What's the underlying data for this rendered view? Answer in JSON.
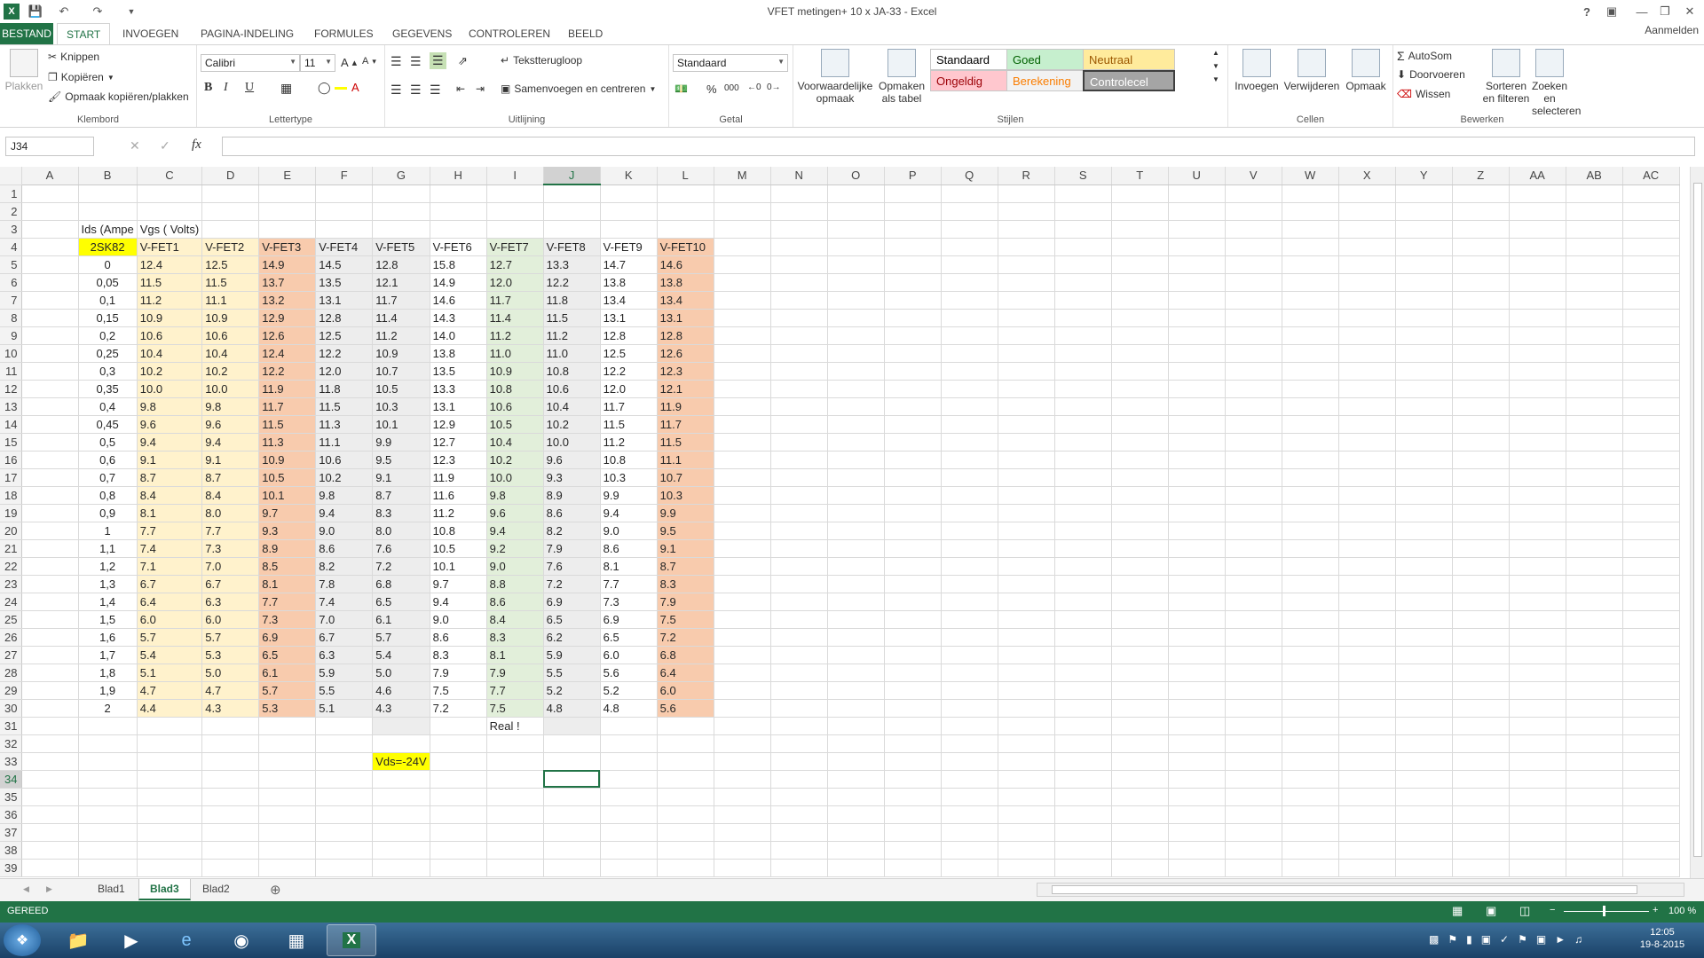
{
  "window": {
    "title": "VFET metingen+ 10 x JA-33 - Excel",
    "signin": "Aanmelden"
  },
  "quick_access": {
    "save_icon": "save-icon",
    "undo_icon": "undo-icon",
    "redo_icon": "redo-icon"
  },
  "ribbon_tabs": [
    "BESTAND",
    "START",
    "INVOEGEN",
    "PAGINA-INDELING",
    "FORMULES",
    "GEGEVENS",
    "CONTROLEREN",
    "BEELD"
  ],
  "clipboard": {
    "paste": "Plakken",
    "cut": "Knippen",
    "copy": "Kopiëren",
    "painter": "Opmaak kopiëren/plakken",
    "label": "Klembord"
  },
  "font": {
    "name": "Calibri",
    "size": "11",
    "label": "Lettertype",
    "bold": "B",
    "italic": "I",
    "underline": "U"
  },
  "alignment": {
    "wrap": "Tekstterugloop",
    "merge": "Samenvoegen en centreren",
    "label": "Uitlijning"
  },
  "number": {
    "format": "Standaard",
    "percent": "%",
    "thousands": "000",
    "label": "Getal"
  },
  "styles": {
    "cond": "Voorwaardelijke opmaak",
    "table": "Opmaken als tabel",
    "cells": [
      {
        "text": "Standaard",
        "bg": "#ffffff",
        "fg": "#000000"
      },
      {
        "text": "Goed",
        "bg": "#c6efce",
        "fg": "#006100"
      },
      {
        "text": "Neutraal",
        "bg": "#ffeb9c",
        "fg": "#9c5700"
      },
      {
        "text": "Ongeldig",
        "bg": "#ffc7ce",
        "fg": "#9c0006"
      },
      {
        "text": "Berekening",
        "bg": "#f2f2f2",
        "fg": "#fa7d00"
      },
      {
        "text": "Controlecel",
        "bg": "#a5a5a5",
        "fg": "#ffffff"
      }
    ],
    "label": "Stijlen"
  },
  "cells_group": {
    "insert": "Invoegen",
    "delete": "Verwijderen",
    "format": "Opmaak",
    "label": "Cellen"
  },
  "editing": {
    "autosum": "AutoSom",
    "fill": "Doorvoeren",
    "clear": "Wissen",
    "sort": "Sorteren en filteren",
    "find": "Zoeken en selecteren",
    "label": "Bewerken"
  },
  "formula_bar": {
    "name_box": "J34",
    "fx": "fx",
    "value": ""
  },
  "columns": [
    "A",
    "B",
    "C",
    "D",
    "E",
    "F",
    "G",
    "H",
    "I",
    "J",
    "K",
    "L",
    "M",
    "N",
    "O",
    "P",
    "Q",
    "R",
    "S",
    "T",
    "U",
    "V",
    "W",
    "X",
    "Y",
    "Z",
    "AA",
    "AB",
    "AC"
  ],
  "sheet": {
    "b3": "Ids (Ampe",
    "c3": "Vgs ( Volts)",
    "headers": [
      "2SK82",
      "V-FET1",
      "V-FET2",
      "V-FET3",
      "V-FET4",
      "V-FET5",
      "V-FET6",
      "V-FET7",
      "V-FET8",
      "V-FET9",
      "V-FET10"
    ],
    "rows": [
      [
        "0",
        "12.4",
        "12.5",
        "14.9",
        "14.5",
        "12.8",
        "15.8",
        "12.7",
        "13.3",
        "14.7",
        "14.6"
      ],
      [
        "0,05",
        "11.5",
        "11.5",
        "13.7",
        "13.5",
        "12.1",
        "14.9",
        "12.0",
        "12.2",
        "13.8",
        "13.8"
      ],
      [
        "0,1",
        "11.2",
        "11.1",
        "13.2",
        "13.1",
        "11.7",
        "14.6",
        "11.7",
        "11.8",
        "13.4",
        "13.4"
      ],
      [
        "0,15",
        "10.9",
        "10.9",
        "12.9",
        "12.8",
        "11.4",
        "14.3",
        "11.4",
        "11.5",
        "13.1",
        "13.1"
      ],
      [
        "0,2",
        "10.6",
        "10.6",
        "12.6",
        "12.5",
        "11.2",
        "14.0",
        "11.2",
        "11.2",
        "12.8",
        "12.8"
      ],
      [
        "0,25",
        "10.4",
        "10.4",
        "12.4",
        "12.2",
        "10.9",
        "13.8",
        "11.0",
        "11.0",
        "12.5",
        "12.6"
      ],
      [
        "0,3",
        "10.2",
        "10.2",
        "12.2",
        "12.0",
        "10.7",
        "13.5",
        "10.9",
        "10.8",
        "12.2",
        "12.3"
      ],
      [
        "0,35",
        "10.0",
        "10.0",
        "11.9",
        "11.8",
        "10.5",
        "13.3",
        "10.8",
        "10.6",
        "12.0",
        "12.1"
      ],
      [
        "0,4",
        "9.8",
        "9.8",
        "11.7",
        "11.5",
        "10.3",
        "13.1",
        "10.6",
        "10.4",
        "11.7",
        "11.9"
      ],
      [
        "0,45",
        "9.6",
        "9.6",
        "11.5",
        "11.3",
        "10.1",
        "12.9",
        "10.5",
        "10.2",
        "11.5",
        "11.7"
      ],
      [
        "0,5",
        "9.4",
        "9.4",
        "11.3",
        "11.1",
        "9.9",
        "12.7",
        "10.4",
        "10.0",
        "11.2",
        "11.5"
      ],
      [
        "0,6",
        "9.1",
        "9.1",
        "10.9",
        "10.6",
        "9.5",
        "12.3",
        "10.2",
        "9.6",
        "10.8",
        "11.1"
      ],
      [
        "0,7",
        "8.7",
        "8.7",
        "10.5",
        "10.2",
        "9.1",
        "11.9",
        "10.0",
        "9.3",
        "10.3",
        "10.7"
      ],
      [
        "0,8",
        "8.4",
        "8.4",
        "10.1",
        "9.8",
        "8.7",
        "11.6",
        "9.8",
        "8.9",
        "9.9",
        "10.3"
      ],
      [
        "0,9",
        "8.1",
        "8.0",
        "9.7",
        "9.4",
        "8.3",
        "11.2",
        "9.6",
        "8.6",
        "9.4",
        "9.9"
      ],
      [
        "1",
        "7.7",
        "7.7",
        "9.3",
        "9.0",
        "8.0",
        "10.8",
        "9.4",
        "8.2",
        "9.0",
        "9.5"
      ],
      [
        "1,1",
        "7.4",
        "7.3",
        "8.9",
        "8.6",
        "7.6",
        "10.5",
        "9.2",
        "7.9",
        "8.6",
        "9.1"
      ],
      [
        "1,2",
        "7.1",
        "7.0",
        "8.5",
        "8.2",
        "7.2",
        "10.1",
        "9.0",
        "7.6",
        "8.1",
        "8.7"
      ],
      [
        "1,3",
        "6.7",
        "6.7",
        "8.1",
        "7.8",
        "6.8",
        "9.7",
        "8.8",
        "7.2",
        "7.7",
        "8.3"
      ],
      [
        "1,4",
        "6.4",
        "6.3",
        "7.7",
        "7.4",
        "6.5",
        "9.4",
        "8.6",
        "6.9",
        "7.3",
        "7.9"
      ],
      [
        "1,5",
        "6.0",
        "6.0",
        "7.3",
        "7.0",
        "6.1",
        "9.0",
        "8.4",
        "6.5",
        "6.9",
        "7.5"
      ],
      [
        "1,6",
        "5.7",
        "5.7",
        "6.9",
        "6.7",
        "5.7",
        "8.6",
        "8.3",
        "6.2",
        "6.5",
        "7.2"
      ],
      [
        "1,7",
        "5.4",
        "5.3",
        "6.5",
        "6.3",
        "5.4",
        "8.3",
        "8.1",
        "5.9",
        "6.0",
        "6.8"
      ],
      [
        "1,8",
        "5.1",
        "5.0",
        "6.1",
        "5.9",
        "5.0",
        "7.9",
        "7.9",
        "5.5",
        "5.6",
        "6.4"
      ],
      [
        "1,9",
        "4.7",
        "4.7",
        "5.7",
        "5.5",
        "4.6",
        "7.5",
        "7.7",
        "5.2",
        "5.2",
        "6.0"
      ],
      [
        "2",
        "4.4",
        "4.3",
        "5.3",
        "5.1",
        "4.3",
        "7.2",
        "7.5",
        "4.8",
        "4.8",
        "5.6"
      ]
    ],
    "i31": "Real !",
    "g33": "Vds=-24V",
    "col_fills": {
      "B": "",
      "C": "#fff2cc",
      "D": "#fff2cc",
      "E": "#f8cbad",
      "F": "#ededed",
      "G": "#ededed",
      "H": "",
      "I": "#e2efda",
      "J": "#ededed",
      "K": "",
      "L": "#f8cbad"
    },
    "yellow": "#ffff00",
    "selected_cell": "J34"
  },
  "sheet_tabs": [
    "Blad1",
    "Blad3",
    "Blad2"
  ],
  "active_sheet": "Blad3",
  "status": {
    "ready": "GEREED",
    "zoom": "100 %"
  },
  "taskbar": {
    "time": "12:05",
    "date": "19-8-2015"
  }
}
